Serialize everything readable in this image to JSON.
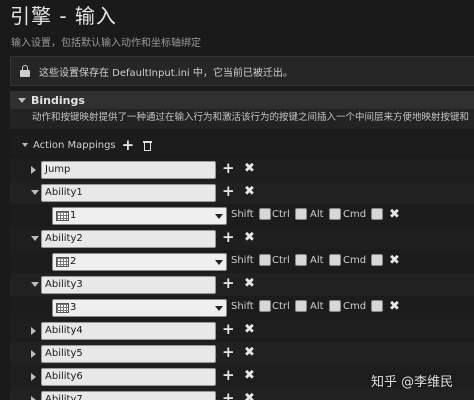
{
  "page": {
    "title": "引擎 - 输入",
    "subtitle": "输入设置，包括默认输入动作和坐标轴绑定"
  },
  "notice": {
    "icon": "lock-icon",
    "text": "这些设置保存在 DefaultInput.ini 中，它当前已被迁出。"
  },
  "bindings": {
    "title": "Bindings",
    "description": "动作和按键映射提供了一种通过在输入行为和激活该行为的按键之间插入一个中间层来方便地映射按键和"
  },
  "action_mappings": {
    "label": "Action Mappings",
    "modifiers": [
      "Shift",
      "Ctrl",
      "Alt",
      "Cmd"
    ],
    "rows": [
      {
        "name": "Jump",
        "expanded": false
      },
      {
        "name": "Ability1",
        "expanded": true,
        "key": "1"
      },
      {
        "name": "Ability2",
        "expanded": true,
        "key": "2"
      },
      {
        "name": "Ability3",
        "expanded": true,
        "key": "3"
      },
      {
        "name": "Ability4",
        "expanded": false
      },
      {
        "name": "Ability5",
        "expanded": false
      },
      {
        "name": "Ability6",
        "expanded": false
      },
      {
        "name": "Ability7",
        "expanded": false
      }
    ]
  },
  "watermark": "知乎 @李维民"
}
